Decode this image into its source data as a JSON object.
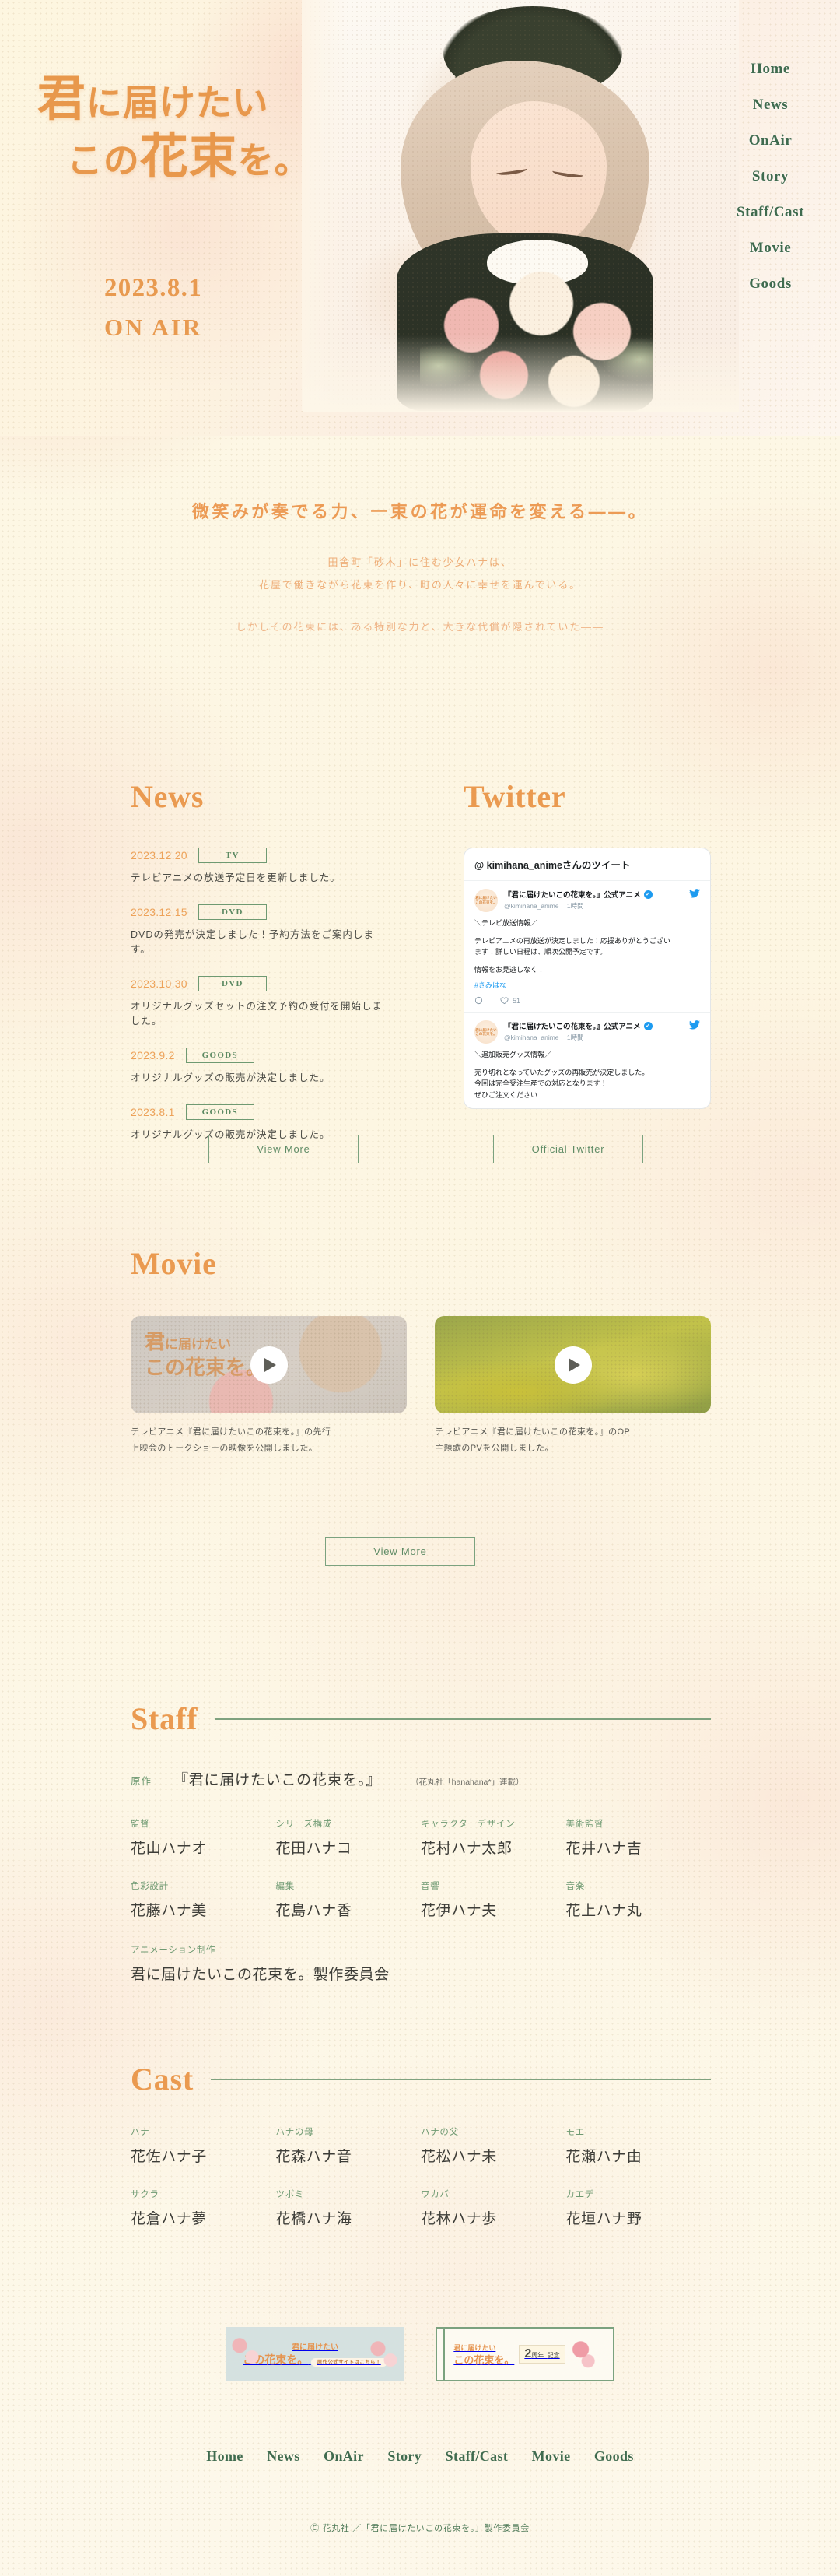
{
  "hero": {
    "title_line1_kanji": "君",
    "title_line1_rest": "に届けたい",
    "title_line2_pre": "この",
    "title_line2_kanji": "花束",
    "title_line2_rest": "を。",
    "date": "2023.8.1",
    "onair": "ON AIR"
  },
  "nav": {
    "items": [
      {
        "label": "Home"
      },
      {
        "label": "News"
      },
      {
        "label": "OnAir"
      },
      {
        "label": "Story"
      },
      {
        "label": "Staff/Cast"
      },
      {
        "label": "Movie"
      },
      {
        "label": "Goods"
      }
    ]
  },
  "intro": {
    "catch": "微笑みが奏でる力、一束の花が運命を変える——。",
    "lead_line1": "田舎町「砂木」に住む少女ハナは、",
    "lead_line2": "花屋で働きながら花束を作り、町の人々に幸せを運んでいる。",
    "lead_line3": "しかしその花束には、ある特別な力と、大きな代償が隠されていた——"
  },
  "news": {
    "heading": "News",
    "items": [
      {
        "date": "2023.12.20",
        "tag": "TV",
        "text": "テレビアニメの放送予定日を更新しました。"
      },
      {
        "date": "2023.12.15",
        "tag": "DVD",
        "text": "DVDの発売が決定しました！予約方法をご案内します。"
      },
      {
        "date": "2023.10.30",
        "tag": "DVD",
        "text": "オリジナルグッズセットの注文予約の受付を開始しました。"
      },
      {
        "date": "2023.9.2",
        "tag": "GOODS",
        "text": "オリジナルグッズの販売が決定しました。"
      },
      {
        "date": "2023.8.1",
        "tag": "GOODS",
        "text": "オリジナルグッズの販売が決定しました。"
      }
    ],
    "view_more": "View More"
  },
  "twitter": {
    "heading": "Twitter",
    "widget_header": "@ kimihana_animeさんのツイート",
    "official_button": "Official Twitter",
    "avatar_line1": "君に届けたい",
    "avatar_line2": "この花束を。",
    "tweets": [
      {
        "name": "『君に届けたいこの花束を。』公式アニメ",
        "handle": "@kimihana_anime",
        "time": "1時間",
        "body_line1": "＼テレビ放送情報／",
        "body_line2": "テレビアニメの再放送が決定しました！応援ありがとうござい",
        "body_line3": "ます！詳しい日程は、順次公開予定です。",
        "body_line4": "情報をお見逃しなく！",
        "hashtag": "#きみはな",
        "likes": "51"
      },
      {
        "name": "『君に届けたいこの花束を。』公式アニメ",
        "handle": "@kimihana_anime",
        "time": "1時間",
        "body_line1": "＼追加販売グッズ情報／",
        "body_line2": "売り切れとなっていたグッズの再販売が決定しました。",
        "body_line3": "今回は完全受注生産での対応となります！",
        "body_line4": "ぜひご注文ください！"
      }
    ]
  },
  "movie": {
    "heading": "Movie",
    "view_more": "View More",
    "items": [
      {
        "caption_line1": "テレビアニメ『君に届けたいこの花束を。』の先行",
        "caption_line2": "上映会のトークショーの映像を公開しました。",
        "thumb_title_line1_kanji": "君",
        "thumb_title_line1_rest": "に届けたい",
        "thumb_title_line2": "この花束を。"
      },
      {
        "caption_line1": "テレビアニメ『君に届けたいこの花束を。』のOP",
        "caption_line2": "主題歌のPVを公開しました。"
      }
    ]
  },
  "staff": {
    "heading": "Staff",
    "original_label": "原作",
    "original_title": "『君に届けたいこの花束を。』",
    "original_note": "（花丸社「hanahana*」連載）",
    "members": [
      {
        "role": "監督",
        "name": "花山ハナオ"
      },
      {
        "role": "シリーズ構成",
        "name": "花田ハナコ"
      },
      {
        "role": "キャラクターデザイン",
        "name": "花村ハナ太郎"
      },
      {
        "role": "美術監督",
        "name": "花井ハナ吉"
      },
      {
        "role": "色彩設計",
        "name": "花藤ハナ美"
      },
      {
        "role": "編集",
        "name": "花島ハナ香"
      },
      {
        "role": "音響",
        "name": "花伊ハナ夫"
      },
      {
        "role": "音楽",
        "name": "花上ハナ丸"
      }
    ],
    "production_role": "アニメーション制作",
    "production_name": "君に届けたいこの花束を。製作委員会"
  },
  "cast": {
    "heading": "Cast",
    "members": [
      {
        "role": "ハナ",
        "name": "花佐ハナ子"
      },
      {
        "role": "ハナの母",
        "name": "花森ハナ音"
      },
      {
        "role": "ハナの父",
        "name": "花松ハナ未"
      },
      {
        "role": "モエ",
        "name": "花瀬ハナ由"
      },
      {
        "role": "サクラ",
        "name": "花倉ハナ夢"
      },
      {
        "role": "ツボミ",
        "name": "花橋ハナ海"
      },
      {
        "role": "ワカバ",
        "name": "花林ハナ歩"
      },
      {
        "role": "カエデ",
        "name": "花垣ハナ野"
      }
    ]
  },
  "banners": [
    {
      "title_line1": "君に届けたい",
      "title_line2": "この花束を。",
      "cta": "原作公式サイトはこちら！"
    },
    {
      "title_line1": "君に届けたい",
      "title_line2": "この花束を。",
      "anniv_number": "2",
      "anniv_unit": "周年",
      "anniv_word": "記念"
    }
  ],
  "footer": {
    "nav": [
      {
        "label": "Home"
      },
      {
        "label": "News"
      },
      {
        "label": "OnAir"
      },
      {
        "label": "Story"
      },
      {
        "label": "Staff/Cast"
      },
      {
        "label": "Movie"
      },
      {
        "label": "Goods"
      }
    ],
    "copyright": "Ⓒ 花丸社 ／「君に届けたいこの花束を。」製作委員会"
  }
}
